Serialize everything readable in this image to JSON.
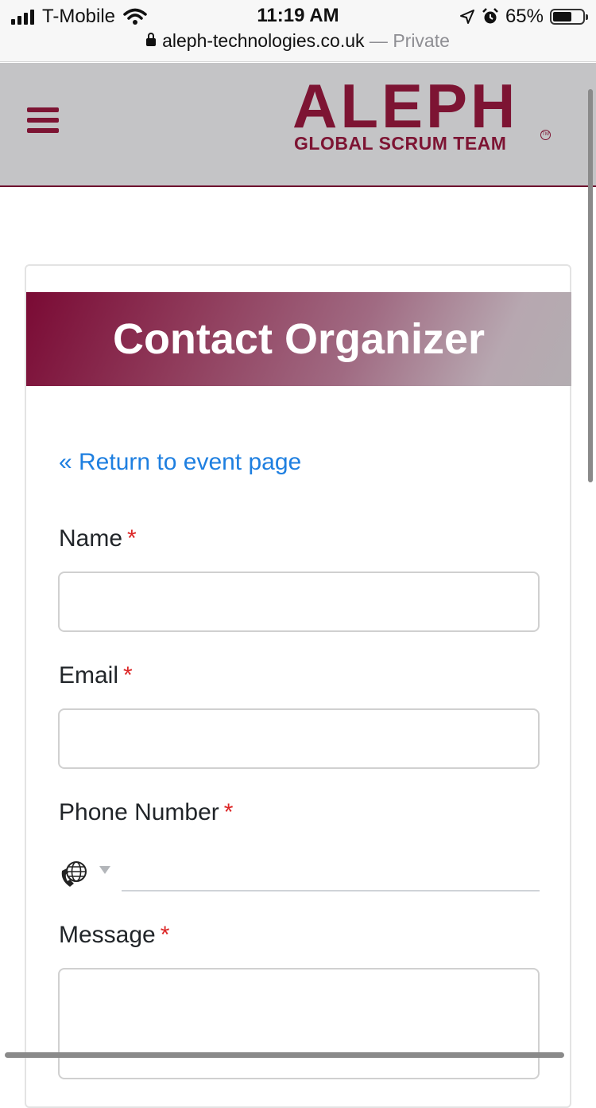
{
  "status_bar": {
    "carrier": "T-Mobile",
    "time": "11:19 AM",
    "battery_percent": "65%",
    "battery_level": 0.65
  },
  "address_bar": {
    "url": "aleph-technologies.co.uk",
    "separator": " — ",
    "mode": "Private"
  },
  "header": {
    "menu_icon": "hamburger-menu-icon",
    "logo_main": "ALEPH",
    "logo_sub": "GLOBAL SCRUM TEAM",
    "logo_mark": "TM",
    "brand_color": "#7d1433"
  },
  "card": {
    "title": "Contact Organizer",
    "return_link": "« Return to event page"
  },
  "form": {
    "required_marker": "*",
    "name_label": "Name",
    "email_label": "Email",
    "phone_label": "Phone Number",
    "phone_country_icon": "globe-phone-icon",
    "message_label": "Message",
    "name_value": "",
    "email_value": "",
    "phone_value": "",
    "message_value": ""
  },
  "colors": {
    "link": "#1e7fe0",
    "required": "#dc2626",
    "banner_start": "#7a0a34",
    "banner_end": "#b3adb1"
  }
}
